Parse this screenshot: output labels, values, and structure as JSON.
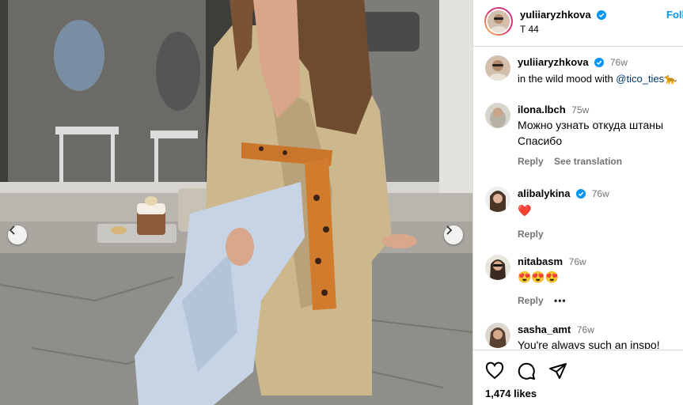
{
  "colors": {
    "accent": "#0095f6",
    "verified": "#0095f6",
    "heart": "#ed1c24"
  },
  "photo": {
    "prev_icon": "chevron-left-icon",
    "next_icon": "chevron-right-icon"
  },
  "header": {
    "username": "yuliiaryzhkova",
    "subtitle": "T 44",
    "follow_label": "Foll"
  },
  "comments": [
    {
      "username": "yuliiaryzhkova",
      "time": "76w",
      "verified": true,
      "text": "in the wild mood with ",
      "mention": "@tico_ties",
      "emoji": "🐆"
    },
    {
      "username": "ilona.lbch",
      "time": "75w",
      "lines": [
        "Можно узнать откуда штаны",
        "Спасибо"
      ],
      "reply": "Reply",
      "translate": "See translation"
    },
    {
      "username": "alibalykina",
      "time": "76w",
      "verified": true,
      "text": "❤️",
      "reply": "Reply"
    },
    {
      "username": "nitabasm",
      "time": "76w",
      "text": "😍😍😍",
      "reply": "Reply",
      "more": "•••"
    },
    {
      "username": "sasha_amt",
      "time": "76w",
      "text": "You're always such an inspo!"
    }
  ],
  "footer": {
    "like_icon": "heart-outline-icon",
    "comment_icon": "comment-icon",
    "share_icon": "send-icon",
    "likes": "1,474 likes"
  }
}
